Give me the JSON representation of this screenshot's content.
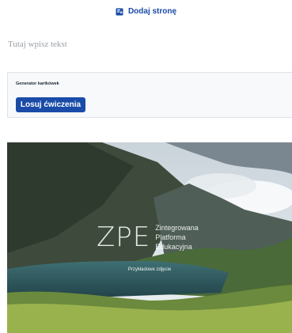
{
  "toolbar": {
    "add_page_label": "Dodaj stronę",
    "add_page_icon": "add-page-icon"
  },
  "editor": {
    "placeholder": "Tutaj wpisz tekst"
  },
  "generator": {
    "title": "Generator kartkówek",
    "button_label": "Losuj ćwiczenia"
  },
  "image": {
    "logo_mark": "ZPE",
    "logo_lines": [
      "Zintegrowana",
      "Platforma",
      "Edukacyjna"
    ],
    "caption": "Przykładowe zdjęcie"
  },
  "colors": {
    "accent": "#1a4ba8"
  }
}
